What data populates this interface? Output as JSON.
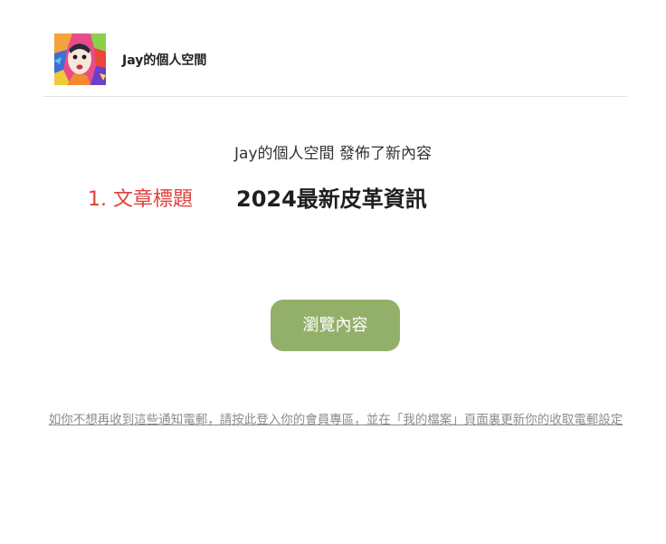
{
  "header": {
    "site_name": "Jay的個人空間",
    "avatar_icon": "abstract-portrait-avatar"
  },
  "notice": {
    "published_text": "Jay的個人空間 發佈了新內容"
  },
  "annotation": {
    "label": "1. 文章標題",
    "color": "#e0403a"
  },
  "article": {
    "title": "2024最新皮革資訊"
  },
  "cta": {
    "label": "瀏覽內容",
    "color": "#93b06b"
  },
  "footer": {
    "unsubscribe_text": "如你不想再收到這些通知電郵，請按此登入你的會員專區，並在「我的檔案」頁面裏更新你的收取電郵設定"
  }
}
